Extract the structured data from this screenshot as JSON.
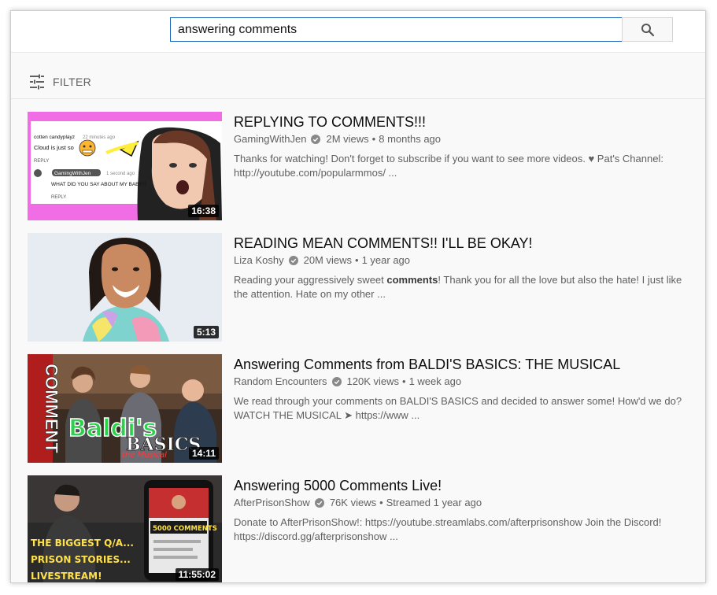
{
  "search": {
    "query": "answering comments"
  },
  "filter": {
    "label": "FILTER"
  },
  "results": [
    {
      "title": "REPLYING TO COMMENTS!!!",
      "channel": "GamingWithJen",
      "views": "2M views",
      "sep": "•",
      "age": "8 months ago",
      "description": "Thanks for watching! Don't forget to subscribe if you want to see more videos. ♥ Pat's Channel: http://youtube.com/popularmmos/ ...",
      "duration": "16:38",
      "thumb_text": {
        "user1": "cotten candyplayz",
        "time1": "22 minutes ago",
        "comment1": "Cloud is just so",
        "reply1": "REPLY",
        "user2": "GamingWithJen",
        "time2": "1 second ago",
        "comment2": "WHAT DID YOU SAY ABOUT MY BABY!?",
        "reply2": "REPLY"
      }
    },
    {
      "title": "READING MEAN COMMENTS!! I'LL BE OKAY!",
      "channel": "Liza Koshy",
      "views": "20M views",
      "sep": "•",
      "age": "1 year ago",
      "description_pre": "Reading your aggressively sweet ",
      "description_bold": "comments",
      "description_post": "! Thank you for all the love but also the hate! I just like the attention. Hate on my other ...",
      "duration": "5:13"
    },
    {
      "title": "Answering Comments from BALDI'S BASICS: THE MUSICAL",
      "channel": "Random Encounters",
      "views": "120K views",
      "sep": "•",
      "age": "1 week ago",
      "description": "We read through your comments on BALDI'S BASICS and decided to answer some! How'd we do? WATCH THE MUSICAL ➤ https://www ...",
      "duration": "14:11",
      "thumb_text": {
        "side": "COMMENT",
        "logo1": "Baldi's",
        "logo2": "BASICS",
        "logo3": "the Musical"
      }
    },
    {
      "title": "Answering 5000 Comments Live!",
      "channel": "AfterPrisonShow",
      "views": "76K views",
      "sep": "•",
      "age": "Streamed 1 year ago",
      "description": "Donate to AfterPrisonShow!: https://youtube.streamlabs.com/afterprisonshow Join the Discord! https://discord.gg/afterprisonshow ...",
      "duration": "11:55:02",
      "thumb_text": {
        "line1": "THE BIGGEST Q/A...",
        "line2": "PRISON STORIES...",
        "line3": "LIVESTREAM!",
        "phone": "5000 COMMENTS"
      }
    }
  ]
}
